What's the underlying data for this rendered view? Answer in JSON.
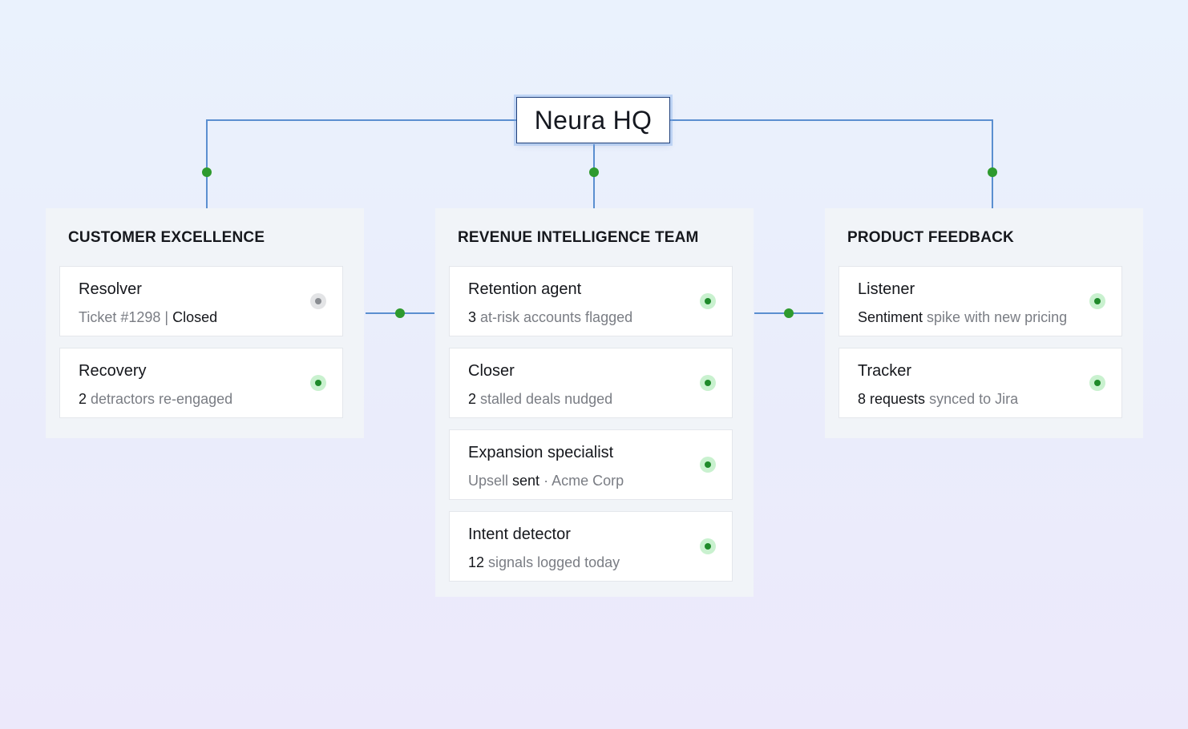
{
  "root": {
    "label": "Neura HQ"
  },
  "colors": {
    "connector": "#5b8fd0",
    "node_dot": "#2e9a2e",
    "active": "#1f8a2a",
    "idle": "#8a8d92"
  },
  "teams": [
    {
      "title": "CUSTOMER EXCELLENCE",
      "agents": [
        {
          "name": "Resolver",
          "status": "idle",
          "detail": [
            [
              "Ticket #1298 | ",
              false
            ],
            [
              "Closed",
              true
            ]
          ]
        },
        {
          "name": "Recovery",
          "status": "active",
          "detail": [
            [
              "2",
              true
            ],
            [
              " detractors re-engaged",
              false
            ]
          ]
        }
      ]
    },
    {
      "title": "REVENUE INTELLIGENCE TEAM",
      "agents": [
        {
          "name": "Retention agent",
          "status": "active",
          "detail": [
            [
              "3",
              true
            ],
            [
              " at-risk accounts flagged",
              false
            ]
          ]
        },
        {
          "name": "Closer",
          "status": "active",
          "detail": [
            [
              "2",
              true
            ],
            [
              " stalled deals nudged",
              false
            ]
          ]
        },
        {
          "name": "Expansion specialist",
          "status": "active",
          "detail": [
            [
              "Upsell ",
              false
            ],
            [
              "sent",
              true
            ],
            [
              " · Acme Corp",
              false
            ]
          ]
        },
        {
          "name": "Intent detector",
          "status": "active",
          "detail": [
            [
              "12",
              true
            ],
            [
              " signals logged today",
              false
            ]
          ]
        }
      ]
    },
    {
      "title": "PRODUCT FEEDBACK",
      "agents": [
        {
          "name": "Listener",
          "status": "active",
          "detail": [
            [
              "Sentiment",
              true
            ],
            [
              " spike with new pricing",
              false
            ]
          ]
        },
        {
          "name": "Tracker",
          "status": "active",
          "detail": [
            [
              "8 requests",
              true
            ],
            [
              " synced to Jira",
              false
            ]
          ]
        }
      ]
    }
  ]
}
